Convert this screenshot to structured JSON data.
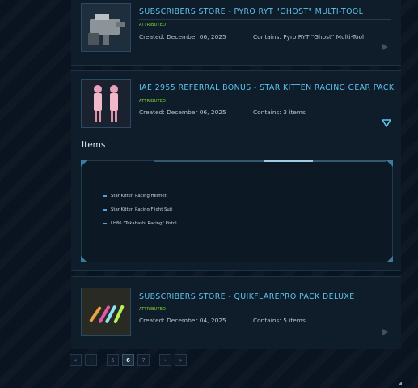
{
  "entries": [
    {
      "title": "SUBSCRIBERS STORE - PYRO RYT \"GHOST\" MULTI-TOOL",
      "attributed": "ATTRIBUTED",
      "created": "Created: December 06, 2025",
      "contains": "Contains: Pyro RYT \"Ghost\" Multi-Tool"
    },
    {
      "title": "IAE 2955 REFERRAL BONUS - STAR KITTEN RACING GEAR PACK",
      "attributed": "ATTRIBUTED",
      "created": "Created: December 06, 2025",
      "contains": "Contains: 3 items"
    },
    {
      "title": "SUBSCRIBERS STORE - QUIKFLAREPRO PACK DELUXE",
      "attributed": "ATTRIBUTED",
      "created": "Created: December 04, 2025",
      "contains": "Contains: 5 items"
    }
  ],
  "items_section": {
    "heading": "Items",
    "list": [
      "Star Kitten Racing Helmet",
      "Star Kitten Racing Flight Suit",
      "LH86 \"Takahashi Racing\" Pistol"
    ]
  },
  "pagination": {
    "first": "«",
    "prev": "‹",
    "pages": [
      "5",
      "6",
      "7"
    ],
    "current": "6",
    "next": "›",
    "last": "»"
  },
  "colors": {
    "accent": "#5ec4ee",
    "attributed": "#7fd83a"
  }
}
